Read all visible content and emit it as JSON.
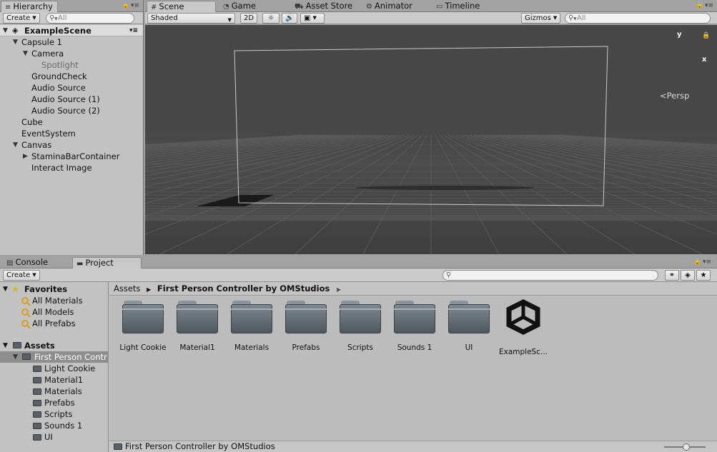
{
  "hierarchy": {
    "tab": "Hierarchy",
    "create_label": "Create",
    "search_placeholder": "All",
    "scene_name": "ExampleScene",
    "items": [
      {
        "label": "Capsule 1",
        "depth": 1,
        "expand": "open"
      },
      {
        "label": "Camera",
        "depth": 2,
        "expand": "open"
      },
      {
        "label": "Spotlight",
        "depth": 3,
        "expand": "none",
        "muted": true
      },
      {
        "label": "GroundCheck",
        "depth": 2,
        "expand": "none"
      },
      {
        "label": "Audio Source",
        "depth": 2,
        "expand": "none"
      },
      {
        "label": "Audio Source (1)",
        "depth": 2,
        "expand": "none"
      },
      {
        "label": "Audio Source (2)",
        "depth": 2,
        "expand": "none"
      },
      {
        "label": "Cube",
        "depth": 1,
        "expand": "none"
      },
      {
        "label": "EventSystem",
        "depth": 1,
        "expand": "none"
      },
      {
        "label": "Canvas",
        "depth": 1,
        "expand": "open"
      },
      {
        "label": "StaminaBarContainer",
        "depth": 2,
        "expand": "closed"
      },
      {
        "label": "Interact Image",
        "depth": 2,
        "expand": "none"
      }
    ]
  },
  "scene": {
    "tabs": [
      {
        "label": "Scene",
        "icon": "grid-icon",
        "glyph": "#",
        "active": true
      },
      {
        "label": "Game",
        "icon": "pacman-icon",
        "glyph": "◔",
        "active": false
      },
      {
        "label": "Asset Store",
        "icon": "bag-icon",
        "glyph": "⛟",
        "active": false
      },
      {
        "label": "Animator",
        "icon": "animator-icon",
        "glyph": "⚙",
        "active": false
      },
      {
        "label": "Timeline",
        "icon": "timeline-icon",
        "glyph": "▭",
        "active": false
      }
    ],
    "shading_mode": "Shaded",
    "mode_2d": "2D",
    "gizmos_label": "Gizmos",
    "search_placeholder": "All",
    "gizmo_y": "y",
    "gizmo_x": "x",
    "persp_label": "Persp"
  },
  "bottom": {
    "tabs": [
      {
        "label": "Console",
        "icon": "console-icon",
        "active": false
      },
      {
        "label": "Project",
        "icon": "folder-icon",
        "active": true
      }
    ],
    "create_label": "Create",
    "favorites": {
      "title": "Favorites",
      "items": [
        "All Materials",
        "All Models",
        "All Prefabs"
      ]
    },
    "assets": {
      "title": "Assets",
      "selected": "First Person Contr",
      "children": [
        "Light Cookie",
        "Material1",
        "Materials",
        "Prefabs",
        "Scripts",
        "Sounds 1",
        "UI"
      ]
    },
    "breadcrumb": {
      "root": "Assets",
      "current": "First Person Controller by OMStudios"
    },
    "grid_items": [
      {
        "label": "Light Cookie",
        "type": "folder"
      },
      {
        "label": "Material1",
        "type": "folder"
      },
      {
        "label": "Materials",
        "type": "folder"
      },
      {
        "label": "Prefabs",
        "type": "folder"
      },
      {
        "label": "Scripts",
        "type": "folder"
      },
      {
        "label": "Sounds 1",
        "type": "folder"
      },
      {
        "label": "UI",
        "type": "folder"
      },
      {
        "label": "ExampleSc...",
        "type": "unity-scene"
      }
    ],
    "status_path": "First Person Controller by OMStudios"
  },
  "colors": {
    "viewport_bg": "#474747",
    "panel_bg": "#c2c2c2",
    "selection": "#8e8e8e"
  }
}
